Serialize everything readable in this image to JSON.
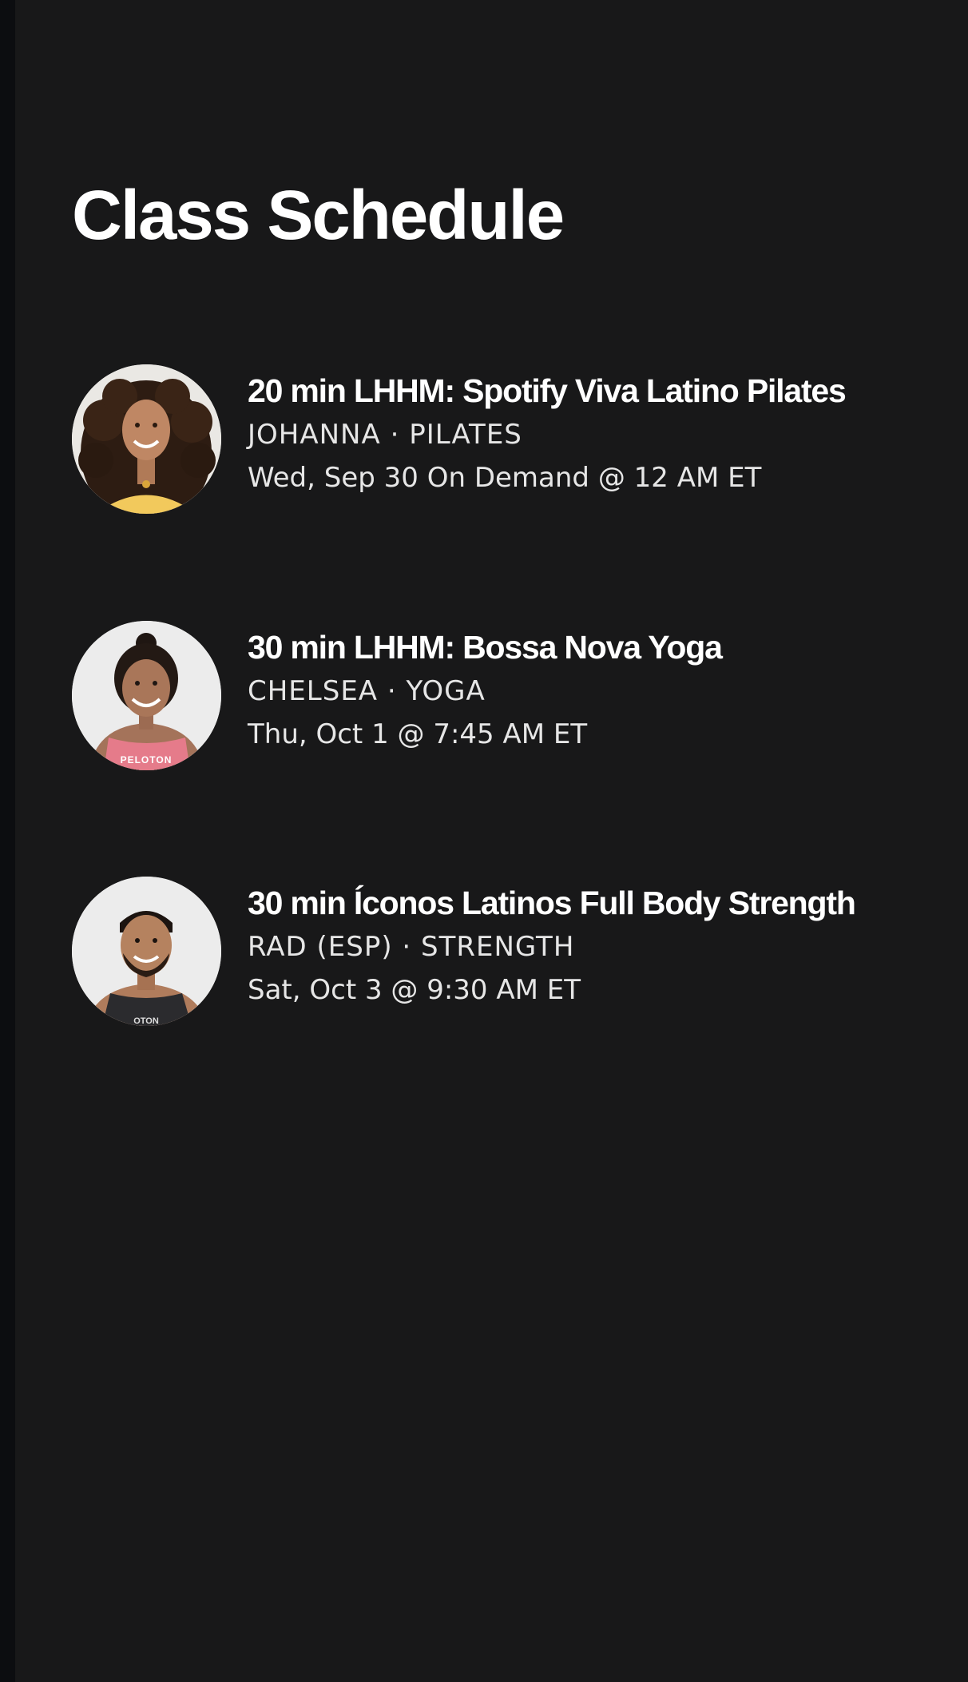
{
  "page_title": "Class Schedule",
  "classes": [
    {
      "title": "20 min LHHM: Spotify Viva Latino Pilates",
      "instructor": "JOHANNA",
      "separator": "·",
      "category": "PILATES",
      "time": "Wed, Sep 30 On Demand @ 12 AM ET",
      "avatar_icon": "instructor-photo-johanna"
    },
    {
      "title": "30 min LHHM: Bossa Nova Yoga",
      "instructor": "CHELSEA",
      "separator": "·",
      "category": "YOGA",
      "time": "Thu, Oct 1 @ 7:45 AM ET",
      "avatar_icon": "instructor-photo-chelsea",
      "shirt_text": "PELOTON"
    },
    {
      "title": "30 min Íconos Latinos Full Body Strength",
      "instructor": "RAD (ESP)",
      "separator": "·",
      "category": "STRENGTH",
      "time": "Sat, Oct 3 @ 9:30 AM ET",
      "avatar_icon": "instructor-photo-rad",
      "shirt_text": "OTON"
    }
  ],
  "colors": {
    "background": "#181819",
    "left_edge": "#0c0d10",
    "title_text": "#ffffff",
    "secondary_text": "#e6e6e6"
  }
}
